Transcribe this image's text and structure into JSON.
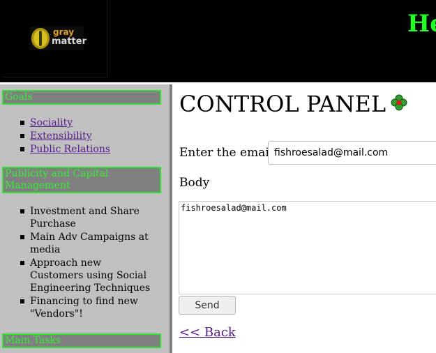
{
  "header": {
    "logo_line1": "gray",
    "logo_line2": "matter",
    "title": "Hel"
  },
  "sidebar": {
    "sections": [
      {
        "title": "Goals",
        "items": [
          "Sociality",
          "Extensibility",
          "Public Relations"
        ]
      },
      {
        "title": "Publicity and Capital Management",
        "items": [
          "Investment and Share Purchase",
          "Main Adv Campaigns at media",
          "Approach new Customers using Social Engineering Techniques",
          "Financing to find new \"Vendors\"!"
        ]
      },
      {
        "title": "Main Tasks"
      }
    ]
  },
  "main": {
    "title": "CONTROL PANEL",
    "title_icon": "clover-icon",
    "email_label": "Enter the email",
    "email_value": "fishroesalad@mail.com",
    "body_label": "Body",
    "body_value": "fishroesalad@mail.com",
    "send_label": "Send",
    "back_label": "<< Back"
  },
  "colors": {
    "header_bg": "#000000",
    "header_title": "#22ff22",
    "sidebar_bg": "#c0c0c0",
    "section_title_bg": "#808080",
    "section_title_text": "#33ee33",
    "link": "#551a8b"
  }
}
